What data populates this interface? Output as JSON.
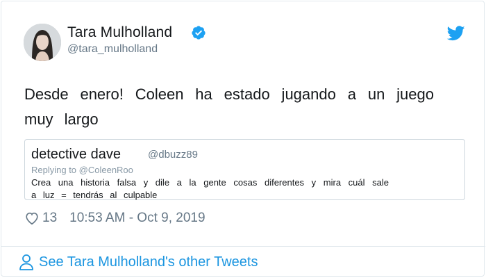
{
  "tweet": {
    "author_name": "Tara Mulholland",
    "author_handle": "@tara_mulholland",
    "text": "Desde enero! Coleen ha estado jugando a un juego muy largo",
    "likes": "13",
    "timestamp": "10:53 AM - Oct 9, 2019",
    "icons": {
      "verified": "verified-badge-icon",
      "brand": "twitter-bird-icon",
      "like": "heart-icon",
      "profile": "person-icon"
    },
    "colors": {
      "accent": "#1da1f2",
      "link": "#1b95e0",
      "muted": "#657786"
    }
  },
  "quoted": {
    "author_name": "detective dave",
    "author_handle": "@dbuzz89",
    "replying_to": "Replying to @ColeenRoo",
    "text": "Crea una historia falsa y dile a la gente cosas diferentes y mira cuál sale a luz = tendrás al culpable"
  },
  "footer": {
    "link_text": "See Tara Mulholland's other Tweets"
  }
}
